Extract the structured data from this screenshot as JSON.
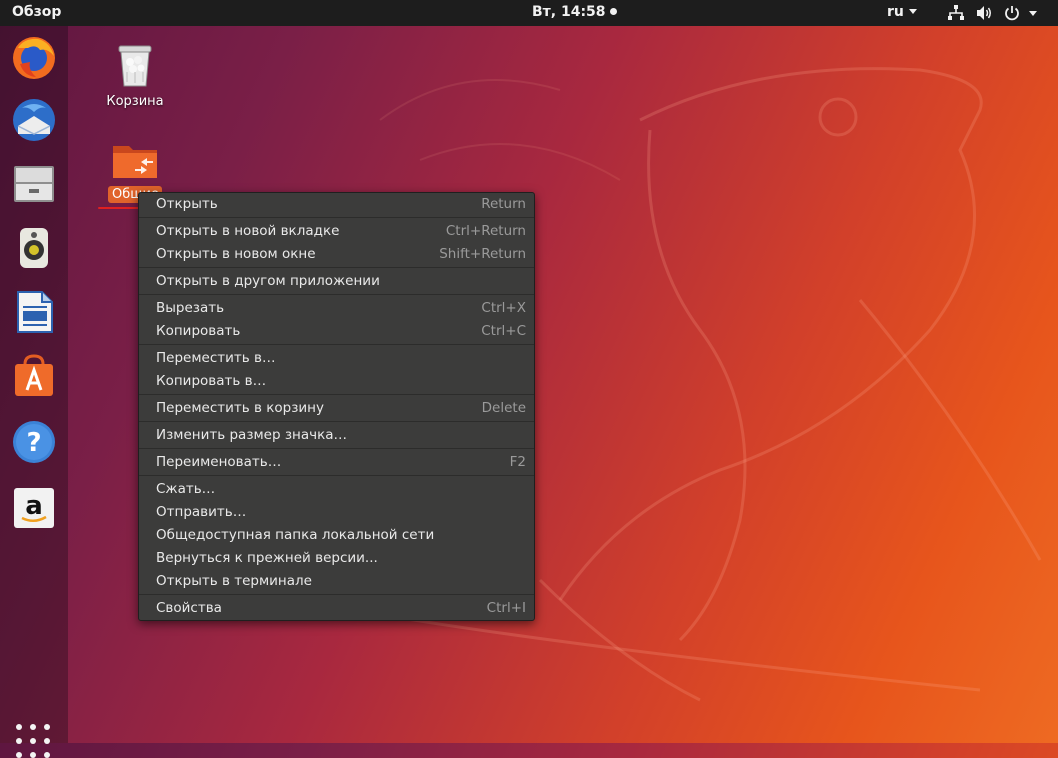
{
  "topbar": {
    "activities": "Обзор",
    "clock": "Вт, 14:58",
    "language": "ru",
    "icons": [
      "network-icon",
      "volume-icon",
      "power-icon"
    ]
  },
  "dock": {
    "apps": [
      "firefox-icon",
      "thunderbird-icon",
      "files-icon",
      "rhythmbox-icon",
      "libreoffice-writer-icon",
      "software-center-icon",
      "help-icon",
      "amazon-icon"
    ],
    "show_apps": "show-apps-grid-icon"
  },
  "desktop": {
    "trash_label": "Корзина",
    "folder_label": "Общие"
  },
  "context_menu": {
    "groups": [
      [
        {
          "label": "Открыть",
          "shortcut": "Return"
        }
      ],
      [
        {
          "label": "Открыть в новой вкладке",
          "shortcut": "Ctrl+Return"
        },
        {
          "label": "Открыть в новом окне",
          "shortcut": "Shift+Return"
        }
      ],
      [
        {
          "label": "Открыть в другом приложении",
          "shortcut": ""
        }
      ],
      [
        {
          "label": "Вырезать",
          "shortcut": "Ctrl+X"
        },
        {
          "label": "Копировать",
          "shortcut": "Ctrl+C"
        }
      ],
      [
        {
          "label": "Переместить в…",
          "shortcut": ""
        },
        {
          "label": "Копировать в…",
          "shortcut": ""
        }
      ],
      [
        {
          "label": "Переместить в корзину",
          "shortcut": "Delete"
        }
      ],
      [
        {
          "label": "Изменить размер значка…",
          "shortcut": ""
        }
      ],
      [
        {
          "label": "Переименовать…",
          "shortcut": "F2"
        }
      ],
      [
        {
          "label": "Сжать…",
          "shortcut": ""
        },
        {
          "label": "Отправить…",
          "shortcut": ""
        },
        {
          "label": "Общедоступная папка локальной сети",
          "shortcut": ""
        },
        {
          "label": "Вернуться к прежней версии...",
          "shortcut": ""
        },
        {
          "label": "Открыть в терминале",
          "shortcut": ""
        }
      ],
      [
        {
          "label": "Свойства",
          "shortcut": "Ctrl+I"
        }
      ]
    ]
  },
  "colors": {
    "annotation": "#e02020",
    "menu_bg": "#3c3c3b",
    "folder_selected": "#e0632b"
  }
}
